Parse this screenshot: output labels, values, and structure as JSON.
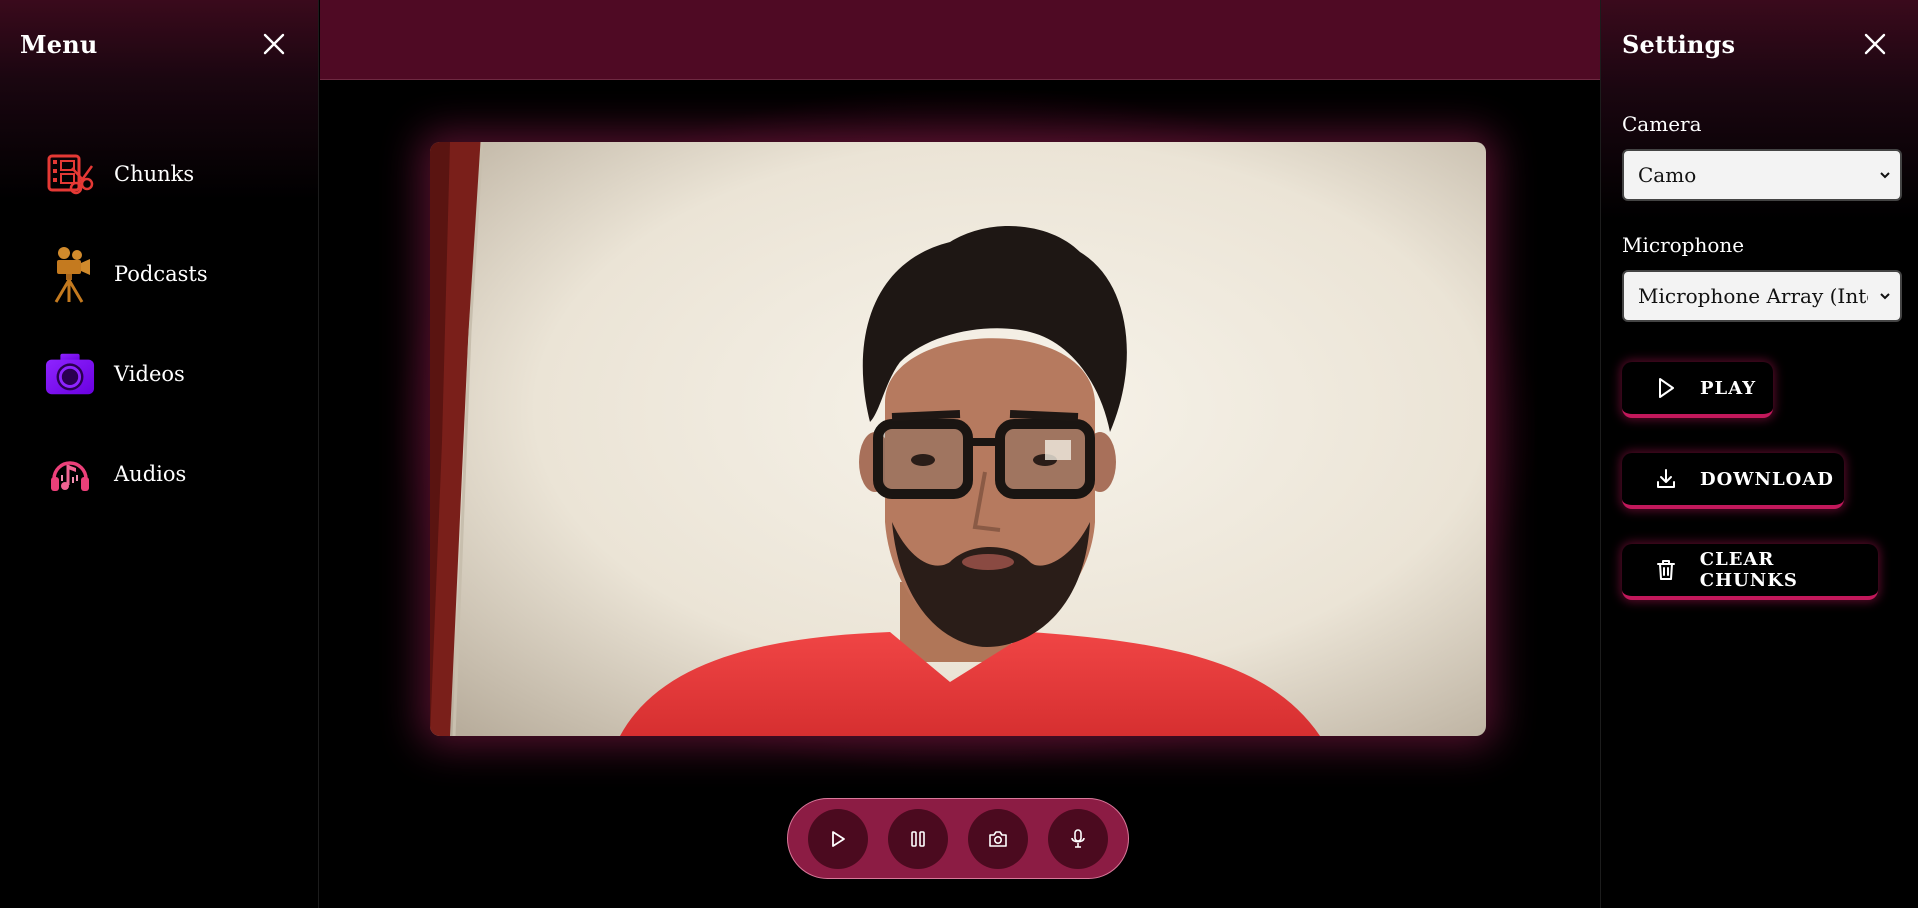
{
  "menu": {
    "title": "Menu",
    "items": [
      {
        "label": "Chunks",
        "icon": "film-scissors-icon"
      },
      {
        "label": "Podcasts",
        "icon": "film-camera-icon"
      },
      {
        "label": "Videos",
        "icon": "camera-icon"
      },
      {
        "label": "Audios",
        "icon": "headphones-music-icon"
      }
    ]
  },
  "settings": {
    "title": "Settings",
    "camera_label": "Camera",
    "camera_value": "Camo",
    "microphone_label": "Microphone",
    "microphone_value": "Microphone Array (Intel®",
    "buttons": {
      "play": "PLAY",
      "download": "DOWNLOAD",
      "clear": "CLEAR CHUNKS"
    }
  },
  "colors": {
    "top_bar": "#4f0a24",
    "accent": "#c2185b",
    "controls_bg": "#8c1c44",
    "control_button": "#4b0a1f"
  }
}
